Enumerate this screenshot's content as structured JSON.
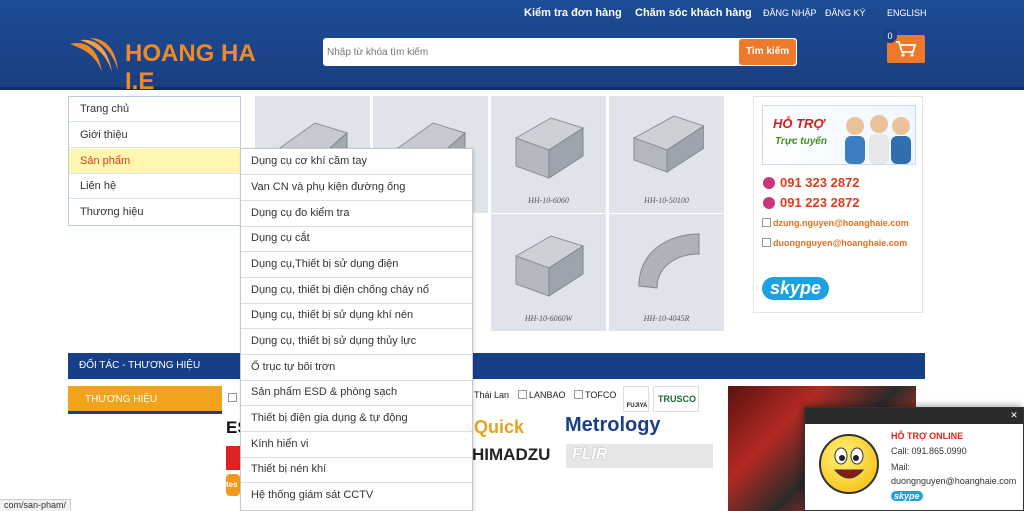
{
  "header": {
    "links": {
      "track_order": "Kiểm tra đơn hàng",
      "customer_care": "Chăm sóc khách hàng",
      "login": "ĐĂNG NHẬP",
      "register": "ĐĂNG KÝ",
      "language": "ENGLISH"
    },
    "logo_text": "HOANG HA I.E",
    "search": {
      "placeholder": "Nhập từ khóa tìm kiếm",
      "button": "Tìm kiếm"
    },
    "cart": {
      "count": "0",
      "icon": "cart-icon"
    },
    "colors": {
      "bar": "#1a3f82",
      "accent": "#ec7a2a"
    }
  },
  "sidebar": {
    "items": [
      {
        "label": "Trang chủ"
      },
      {
        "label": "Giới thiệu"
      },
      {
        "label": "Sản phẩm"
      },
      {
        "label": "Liên hệ"
      },
      {
        "label": "Thương hiệu"
      }
    ]
  },
  "dropdown": {
    "items": [
      {
        "label": "Dụng cụ cơ khí cầm tay"
      },
      {
        "label": "Van CN và phụ kiện đường ống"
      },
      {
        "label": "Dụng cụ đo kiểm tra"
      },
      {
        "label": "Dụng cụ cắt"
      },
      {
        "label": "Dụng cụ,Thiết bị sử dụng điện"
      },
      {
        "label": "Dụng cụ, thiết bị điện chống cháy nổ"
      },
      {
        "label": "Dụng cụ, thiết bị sử dụng khí nén"
      },
      {
        "label": "Dụng cụ, thiết bị sử dụng thủy lực"
      },
      {
        "label": "Ổ trục tự bôi trơn"
      },
      {
        "label": "Sản phẩm ESD & phòng sạch"
      },
      {
        "label": "Thiết bị điện gia dụng & tự động"
      },
      {
        "label": "Kính hiển vi"
      },
      {
        "label": "Thiết bị nén khí"
      },
      {
        "label": "Hệ thống giám sát CCTV"
      }
    ]
  },
  "products": [
    {
      "caption": ""
    },
    {
      "caption": ""
    },
    {
      "caption": "HH-10-6060"
    },
    {
      "caption": "HH-10-50100"
    },
    {
      "caption": "HH-10-6060W"
    },
    {
      "caption": "HH-10-4045R"
    }
  ],
  "support": {
    "title": "HỖ TRỢ",
    "subtitle": "Trực tuyến",
    "phones": [
      "091 323 2872",
      "091 223 2872"
    ],
    "emails": [
      "dzung.nguyen@hoanghaie.com",
      "duongnguyen@hoanghaie.com"
    ],
    "skype": "skype"
  },
  "partners": {
    "bar_title": "ĐỐI TÁC - THƯƠNG HIỆU",
    "tab": "THƯƠNG HIỆU",
    "brands_row1": [
      "Thái Lan",
      "LANBAO",
      "TOFCO",
      "FUJIYA",
      "TRUSCO"
    ],
    "brands_row2": [
      "Quick",
      "Metrology",
      "HIMADZU",
      "FLIR"
    ],
    "partial": [
      "ES",
      "tes"
    ]
  },
  "chat": {
    "title": "HỖ TRỢ ONLINE",
    "call_label": "Call:",
    "call_value": "091.865.0990",
    "mail_label": "Mail:",
    "mail_value": "duongnguyen@hoanghaie.com",
    "skype": "skype"
  },
  "status_url": "com/san-pham/"
}
